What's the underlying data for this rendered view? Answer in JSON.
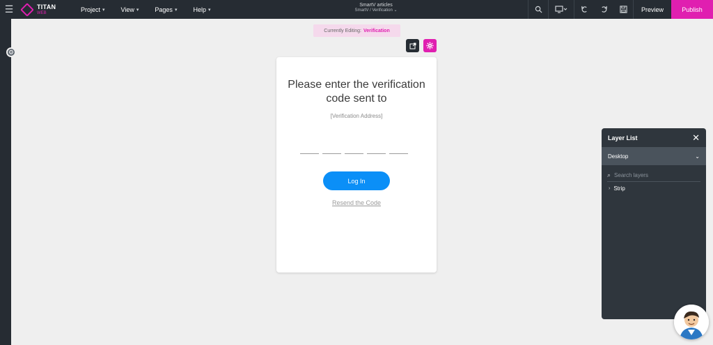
{
  "app": {
    "logo_title": "TITAN",
    "logo_sub": "WEB",
    "brand_color": "#e01fb0"
  },
  "menu": {
    "items": [
      {
        "label": "Project"
      },
      {
        "label": "View"
      },
      {
        "label": "Pages"
      },
      {
        "label": "Help"
      }
    ]
  },
  "header": {
    "project_title": "SmartV articles",
    "breadcrumb": "SmartV / Verification ⌄"
  },
  "toolbar": {
    "preview_label": "Preview",
    "publish_label": "Publish",
    "icons": [
      "search-icon",
      "monitor-icon",
      "undo-icon",
      "redo-icon",
      "save-icon"
    ]
  },
  "editing": {
    "label": "Currently Editing:",
    "value": "Verification"
  },
  "card": {
    "title": "Please enter the verification code sent to",
    "subtitle": "[Verification Address]",
    "code_fields": 5,
    "login_label": "Log In",
    "login_color": "#0b8ff7",
    "resend_label": "Resend the Code"
  },
  "layers": {
    "title": "Layer List",
    "device": "Desktop",
    "search_placeholder": "Search layers",
    "items": [
      {
        "label": "Strip"
      }
    ]
  }
}
